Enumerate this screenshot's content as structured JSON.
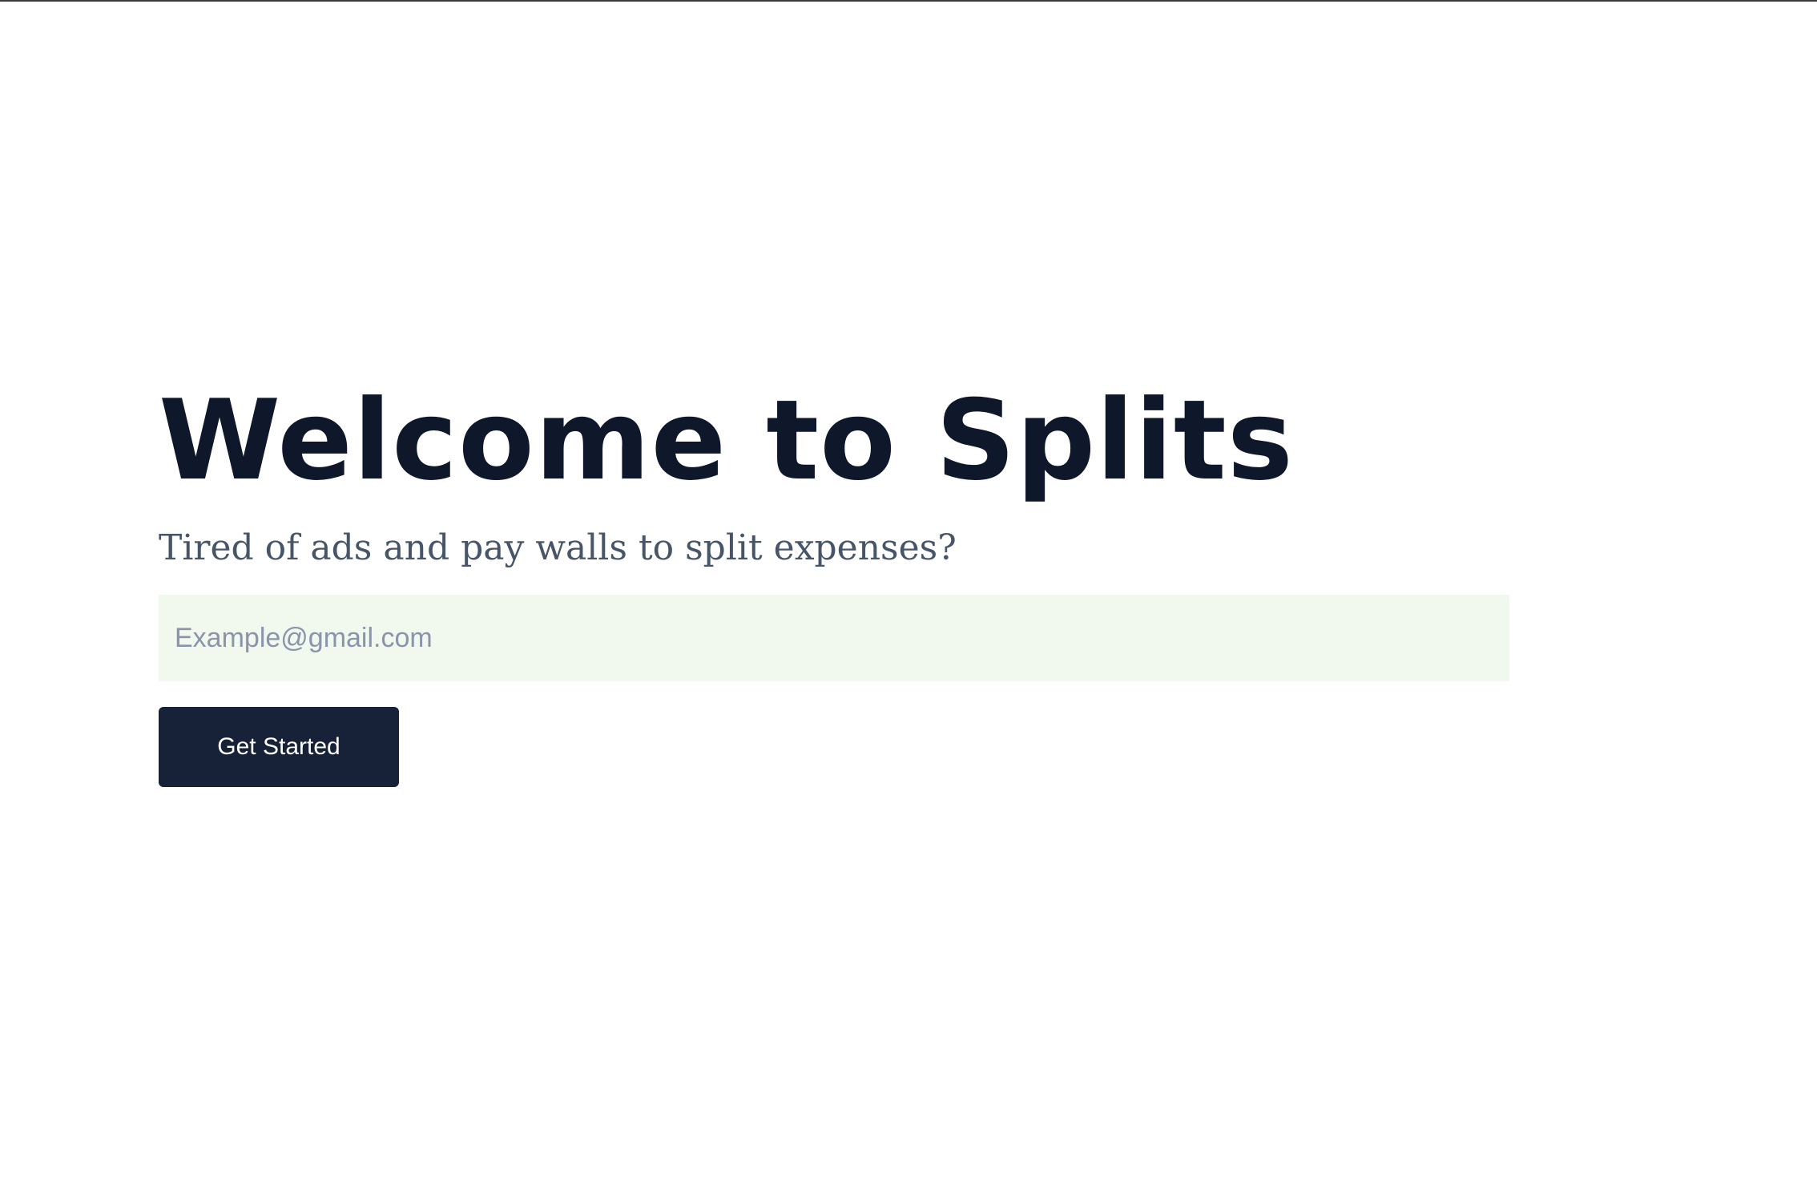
{
  "hero": {
    "title": "Welcome to Splits",
    "subtitle": "Tired of ads and pay walls to split expenses?"
  },
  "signup": {
    "email_value": "",
    "email_placeholder": "Example@gmail.com",
    "submit_label": "Get Started"
  },
  "colors": {
    "title": "#0f172a",
    "subtitle": "#475569",
    "input_background": "#f1f8ee",
    "button_background": "#172239",
    "button_text": "#ffffff"
  }
}
